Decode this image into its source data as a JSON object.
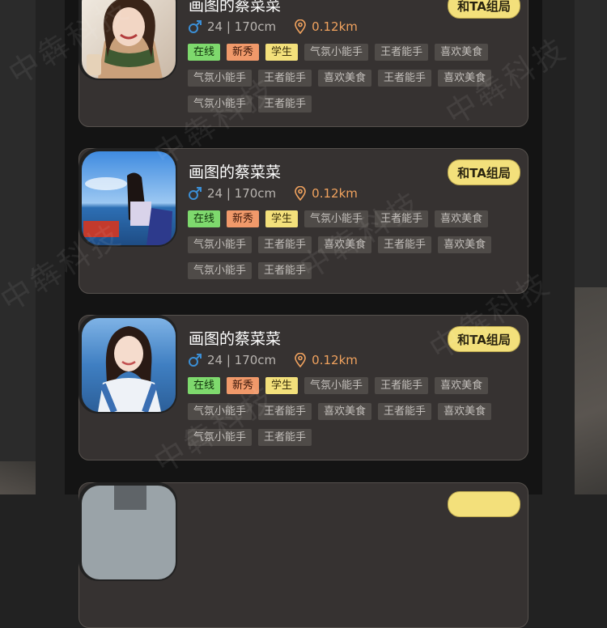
{
  "colors": {
    "accent_yellow": "#f3e07b",
    "tag_online": "#7ed96d",
    "tag_new": "#f0996a",
    "distance_orange": "#f0a25e",
    "gender_blue": "#3b8fd6",
    "card_bg": "#363231"
  },
  "watermark_text": "中犇科技",
  "cards": [
    {
      "name": "画图的蔡菜菜",
      "join_label": "和TA组局",
      "gender_icon": "male-icon",
      "age_height": "24 | 170cm",
      "distance": "0.12km",
      "tags": [
        "在线",
        "新秀",
        "学生",
        "气氛小能手",
        "王者能手",
        "喜欢美食",
        "气氛小能手",
        "王者能手",
        "喜欢美食",
        "王者能手",
        "喜欢美食",
        "气氛小能手",
        "王者能手"
      ]
    },
    {
      "name": "画图的蔡菜菜",
      "join_label": "和TA组局",
      "gender_icon": "male-icon",
      "age_height": "24 | 170cm",
      "distance": "0.12km",
      "tags": [
        "在线",
        "新秀",
        "学生",
        "气氛小能手",
        "王者能手",
        "喜欢美食",
        "气氛小能手",
        "王者能手",
        "喜欢美食",
        "王者能手",
        "喜欢美食",
        "气氛小能手",
        "王者能手"
      ]
    },
    {
      "name": "画图的蔡菜菜",
      "join_label": "和TA组局",
      "gender_icon": "male-icon",
      "age_height": "24 | 170cm",
      "distance": "0.12km",
      "tags": [
        "在线",
        "新秀",
        "学生",
        "气氛小能手",
        "王者能手",
        "喜欢美食",
        "气氛小能手",
        "王者能手",
        "喜欢美食",
        "王者能手",
        "喜欢美食",
        "气氛小能手",
        "王者能手"
      ]
    }
  ]
}
